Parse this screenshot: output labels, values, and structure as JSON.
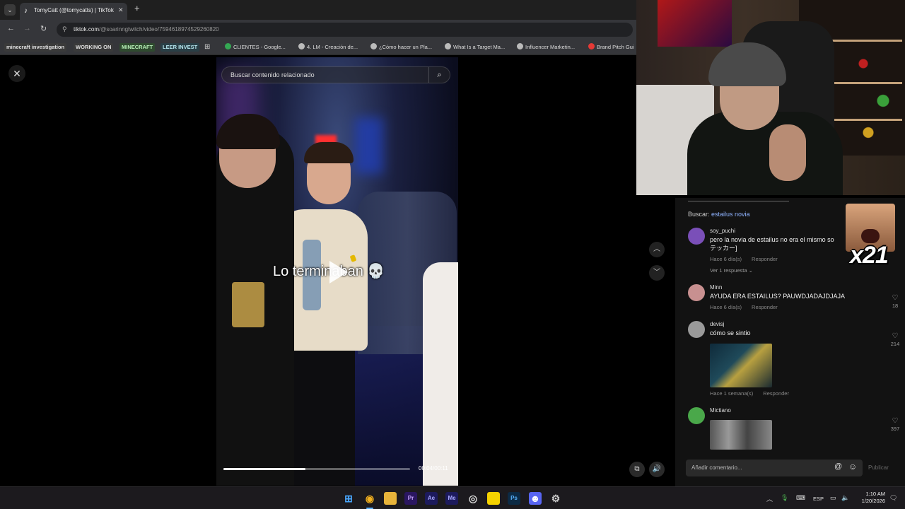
{
  "browser": {
    "tab_title": "TomyCatt (@tomycatts) | TikTok",
    "url_domain": "tiktok.com",
    "url_path": "/@soarinngtwitch/video/7594618974529260820"
  },
  "bookmarks": [
    {
      "label": "minecraft investigation",
      "style": "chip",
      "bg": "#3a3a3a",
      "fg": "#e0e0e0"
    },
    {
      "label": "WORKING ON",
      "style": "chip",
      "bg": "#3a3a3a",
      "fg": "#e0e0e0"
    },
    {
      "label": "MINECRAFT",
      "style": "chip",
      "bg": "#2f4a2f",
      "fg": "#b8f0b8"
    },
    {
      "label": "LEER INVEST",
      "style": "chip",
      "bg": "#2a3f46",
      "fg": "#b8e8f0"
    },
    {
      "label": "CLIENTES - Google...",
      "style": "link",
      "icon": "#34a853"
    },
    {
      "label": "4. LM - Creación de...",
      "style": "link",
      "icon": "#bbbbbb"
    },
    {
      "label": "¿Cómo hacer un Pla...",
      "style": "link",
      "icon": "#bbbbbb"
    },
    {
      "label": "What Is a Target Ma...",
      "style": "link",
      "icon": "#bbbbbb"
    },
    {
      "label": "Influencer Marketin...",
      "style": "link",
      "icon": "#bbbbbb"
    },
    {
      "label": "Brand Pitch Gui",
      "style": "link",
      "icon": "#e53935"
    }
  ],
  "video": {
    "search_placeholder": "Buscar contenido relacionado",
    "caption": "Lo terminaban 💀",
    "time": "00:04/00:11",
    "progress": 0.44
  },
  "comments_panel": {
    "related_label": "Buscar:",
    "related_term": "estailus novia",
    "comments": [
      {
        "user": "soy_puchi",
        "text": "pero la novia de estailus no era el mismo so",
        "text2": "テッカー]",
        "time": "Hace 6 día(s)",
        "reply": "Responder",
        "replies": "Ver 1 respuesta ⌄",
        "avatar": "#7a4fb8"
      },
      {
        "user": "Minn",
        "text": "AYUDA ERA ESTAILUS? PAUWDJADAJDJAJA",
        "time": "Hace 6 día(s)",
        "reply": "Responder",
        "likes": "18",
        "avatar": "#c89090"
      },
      {
        "user": "devisj",
        "text": "cómo se sintio",
        "time": "Hace 1 semana(s)",
        "reply": "Responder",
        "likes": "214",
        "avatar": "#9a9a9a"
      },
      {
        "user": "Mictiano",
        "text": "",
        "likes": "397",
        "avatar": "#4aa84a"
      }
    ],
    "composer_placeholder": "Añadir comentario...",
    "publish_label": "Publicar"
  },
  "overlay": {
    "multiplier": "x21"
  },
  "taskbar": {
    "lang": "ESP",
    "time": "1:10 AM",
    "date": "1/20/2026",
    "apps": [
      {
        "name": "start-button",
        "glyph": "⊞",
        "bg": "transparent",
        "fg": "#4aa8ff"
      },
      {
        "name": "chrome-app",
        "glyph": "◉",
        "bg": "transparent",
        "fg": "#f2b01e"
      },
      {
        "name": "file-explorer-app",
        "glyph": "▬",
        "bg": "#e8b43a",
        "fg": "#e8b43a"
      },
      {
        "name": "premiere-app",
        "glyph": "Pr",
        "bg": "#2a1660",
        "fg": "#c9a8ff"
      },
      {
        "name": "after-effects-app",
        "glyph": "Ae",
        "bg": "#1c1a5c",
        "fg": "#a8a8ff"
      },
      {
        "name": "media-encoder-app",
        "glyph": "Me",
        "bg": "#1c1a5c",
        "fg": "#a8a8ff"
      },
      {
        "name": "obs-app",
        "glyph": "◎",
        "bg": "transparent",
        "fg": "#dddddd"
      },
      {
        "name": "sticky-notes-app",
        "glyph": "■",
        "bg": "#f5d200",
        "fg": "#f5d200"
      },
      {
        "name": "photoshop-app",
        "glyph": "Ps",
        "bg": "#0c2a44",
        "fg": "#5ab4ff"
      },
      {
        "name": "discord-app",
        "glyph": "☻",
        "bg": "#5865f2",
        "fg": "#ffffff"
      },
      {
        "name": "settings-app",
        "glyph": "⚙",
        "bg": "transparent",
        "fg": "#cccccc"
      }
    ]
  }
}
